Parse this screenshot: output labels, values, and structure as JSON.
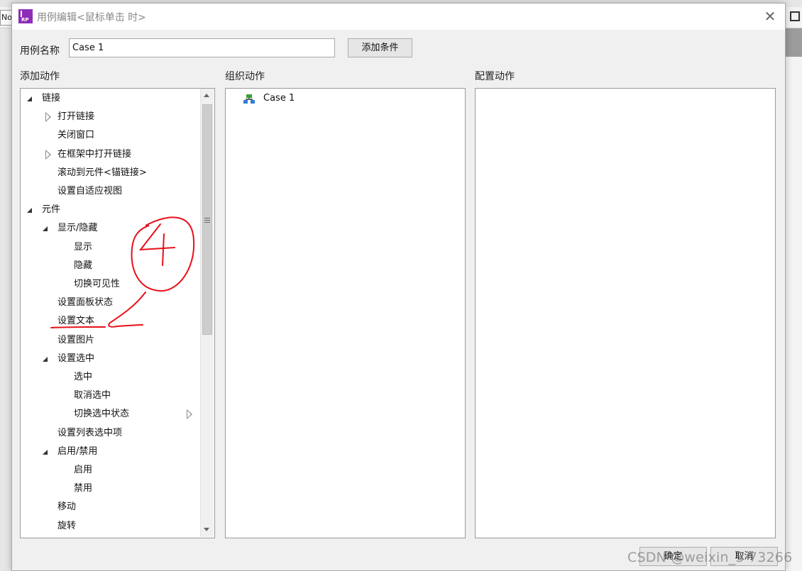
{
  "background": {
    "tab_text": "Nor"
  },
  "dialog": {
    "title": "用例编辑<鼠标单击 时>",
    "logo_text": "RP",
    "case_name_label": "用例名称",
    "case_name_value": "Case 1",
    "add_condition_button": "添加条件",
    "ok_button": "确定",
    "cancel_button": "取消"
  },
  "add_actions": {
    "header": "添加动作",
    "items": [
      {
        "label": "链接",
        "level": 0,
        "expander": "expanded"
      },
      {
        "label": "打开链接",
        "level": 1,
        "expander": "collapsed"
      },
      {
        "label": "关闭窗口",
        "level": 1,
        "expander": "none"
      },
      {
        "label": "在框架中打开链接",
        "level": 1,
        "expander": "collapsed"
      },
      {
        "label": "滚动到元件<锚链接>",
        "level": 1,
        "expander": "none"
      },
      {
        "label": "设置自适应视图",
        "level": 1,
        "expander": "none"
      },
      {
        "label": "元件",
        "level": 0,
        "expander": "expanded"
      },
      {
        "label": "显示/隐藏",
        "level": 1,
        "expander": "expanded"
      },
      {
        "label": "显示",
        "level": 2,
        "expander": "none"
      },
      {
        "label": "隐藏",
        "level": 2,
        "expander": "none"
      },
      {
        "label": "切换可见性",
        "level": 2,
        "expander": "none"
      },
      {
        "label": "设置面板状态",
        "level": 1,
        "expander": "none"
      },
      {
        "label": "设置文本",
        "level": 1,
        "expander": "none"
      },
      {
        "label": "设置图片",
        "level": 1,
        "expander": "none"
      },
      {
        "label": "设置选中",
        "level": 1,
        "expander": "expanded"
      },
      {
        "label": "选中",
        "level": 2,
        "expander": "none"
      },
      {
        "label": "取消选中",
        "level": 2,
        "expander": "none"
      },
      {
        "label": "切换选中状态",
        "level": 2,
        "expander": "none"
      },
      {
        "label": "设置列表选中项",
        "level": 1,
        "expander": "none"
      },
      {
        "label": "启用/禁用",
        "level": 1,
        "expander": "expanded"
      },
      {
        "label": "启用",
        "level": 2,
        "expander": "none"
      },
      {
        "label": "禁用",
        "level": 2,
        "expander": "none"
      },
      {
        "label": "移动",
        "level": 1,
        "expander": "none"
      },
      {
        "label": "旋转",
        "level": 1,
        "expander": "none"
      }
    ]
  },
  "organize_actions": {
    "header": "组织动作",
    "cases": [
      {
        "label": "Case 1",
        "icon": "case-tree-icon"
      }
    ]
  },
  "configure_actions": {
    "header": "配置动作"
  },
  "annotation": {
    "text": "4",
    "color": "#e8101a"
  },
  "watermark": "CSDN @weixin_5    73266"
}
